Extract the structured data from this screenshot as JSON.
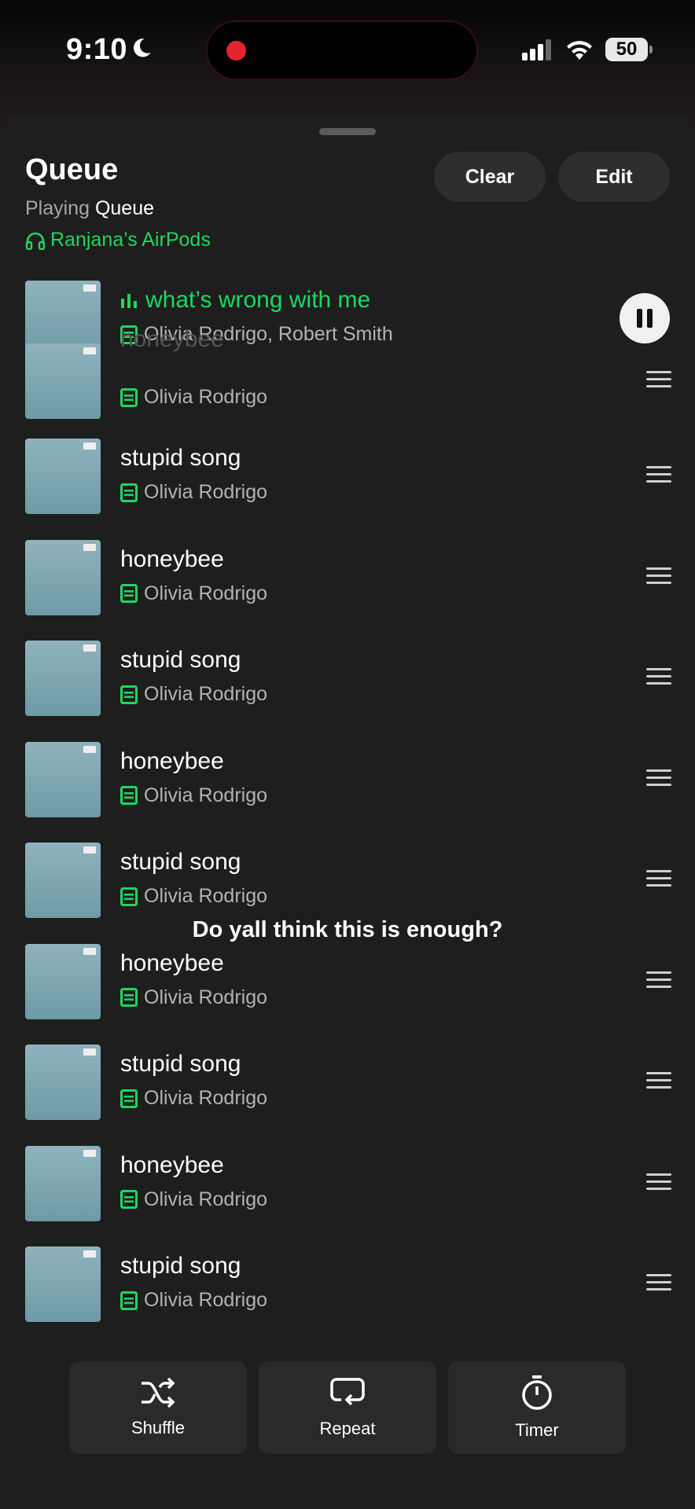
{
  "status": {
    "time": "9:10",
    "battery": "50"
  },
  "header": {
    "title": "Queue",
    "subtitle_prefix": "Playing",
    "subtitle_context": "Queue",
    "device": "Ranjana’s AirPods",
    "clear_label": "Clear",
    "edit_label": "Edit"
  },
  "now_playing": {
    "title": "what’s wrong with me",
    "artist": "Olivia Rodrigo, Robert Smith"
  },
  "queue": [
    {
      "title": "honeybee",
      "artist": "Olivia Rodrigo"
    },
    {
      "title": "stupid song",
      "artist": "Olivia Rodrigo"
    },
    {
      "title": "honeybee",
      "artist": "Olivia Rodrigo"
    },
    {
      "title": "stupid song",
      "artist": "Olivia Rodrigo"
    },
    {
      "title": "honeybee",
      "artist": "Olivia Rodrigo"
    },
    {
      "title": "stupid song",
      "artist": "Olivia Rodrigo"
    },
    {
      "title": "honeybee",
      "artist": "Olivia Rodrigo"
    },
    {
      "title": "stupid song",
      "artist": "Olivia Rodrigo"
    },
    {
      "title": "honeybee",
      "artist": "Olivia Rodrigo"
    },
    {
      "title": "stupid song",
      "artist": "Olivia Rodrigo"
    }
  ],
  "caption": "Do yall think this is enough?",
  "footer": {
    "shuffle_label": "Shuffle",
    "repeat_label": "Repeat",
    "timer_label": "Timer"
  },
  "colors": {
    "accent": "#1ed760",
    "sheet": "#1e1e1e",
    "record": "#e3262e"
  },
  "icons": [
    "moon-icon",
    "signal-icon",
    "wifi-icon",
    "battery-icon",
    "headphones-icon",
    "equalizer-icon",
    "downloaded-icon",
    "pause-icon",
    "drag-handle-icon",
    "shuffle-icon",
    "repeat-icon",
    "timer-icon"
  ]
}
